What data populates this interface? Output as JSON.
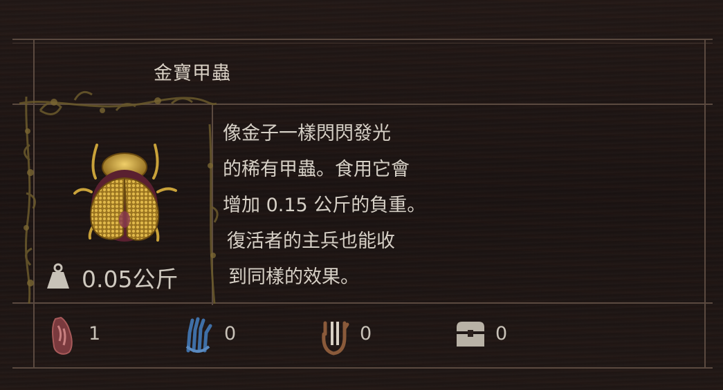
{
  "item": {
    "name": "金寶甲蟲",
    "weight": "0.05公斤",
    "description_lines": [
      "像金子一樣閃閃發光",
      "的稀有甲蟲。食用它會",
      "增加 0.15 公斤的負重。",
      "復活者的主兵也能收",
      "到同樣的效果。"
    ]
  },
  "stats": [
    {
      "icon": "red-hand-icon",
      "value": "1",
      "color": "#8a4a4a"
    },
    {
      "icon": "blue-hand-icon",
      "value": "0",
      "color": "#3f6fa6"
    },
    {
      "icon": "brown-hand-icon",
      "value": "0",
      "color": "#8a5a3a"
    },
    {
      "icon": "chest-icon",
      "value": "0",
      "color": "#b8b2a6"
    }
  ],
  "colors": {
    "frame": "#5b4a40",
    "gold": "#c9a23a",
    "text": "#d8d0c4"
  }
}
